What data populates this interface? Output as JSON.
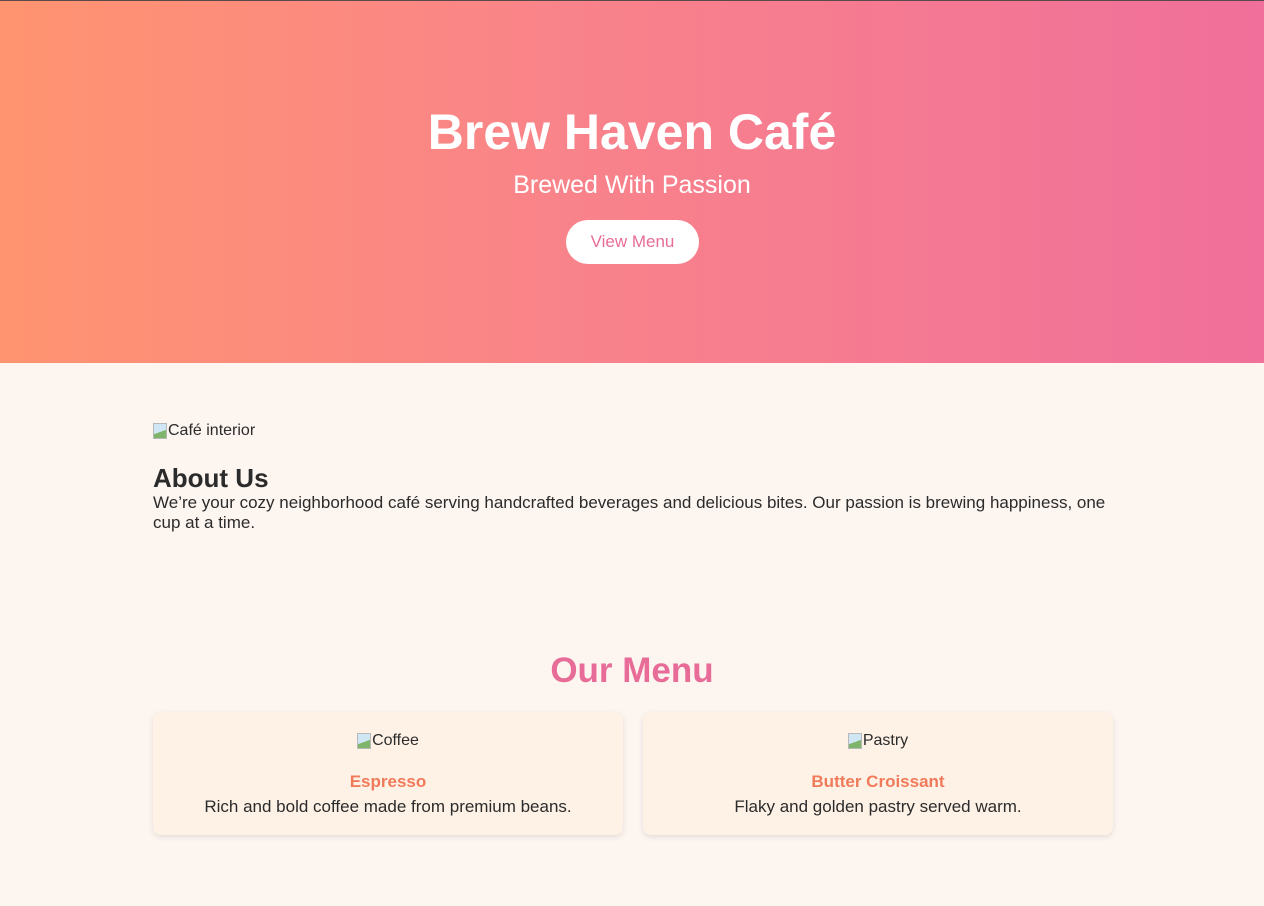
{
  "hero": {
    "title": "Brew Haven Café",
    "tagline": "Brewed With Passion",
    "cta_label": "View Menu"
  },
  "about": {
    "image_alt": "Café interior",
    "heading": "About Us",
    "text": "We’re your cozy neighborhood café serving handcrafted beverages and delicious bites. Our passion is brewing happiness, one cup at a time."
  },
  "menu": {
    "heading": "Our Menu",
    "items": [
      {
        "image_alt": "Coffee",
        "name": "Espresso",
        "description": "Rich and bold coffee made from premium beans."
      },
      {
        "image_alt": "Pastry",
        "name": "Butter Croissant",
        "description": "Flaky and golden pastry served warm."
      }
    ]
  },
  "colors": {
    "accent_pink": "#e86c98",
    "accent_orange": "#f07a5a",
    "page_bg": "#fdf5f0",
    "card_bg": "#fef2e6"
  }
}
